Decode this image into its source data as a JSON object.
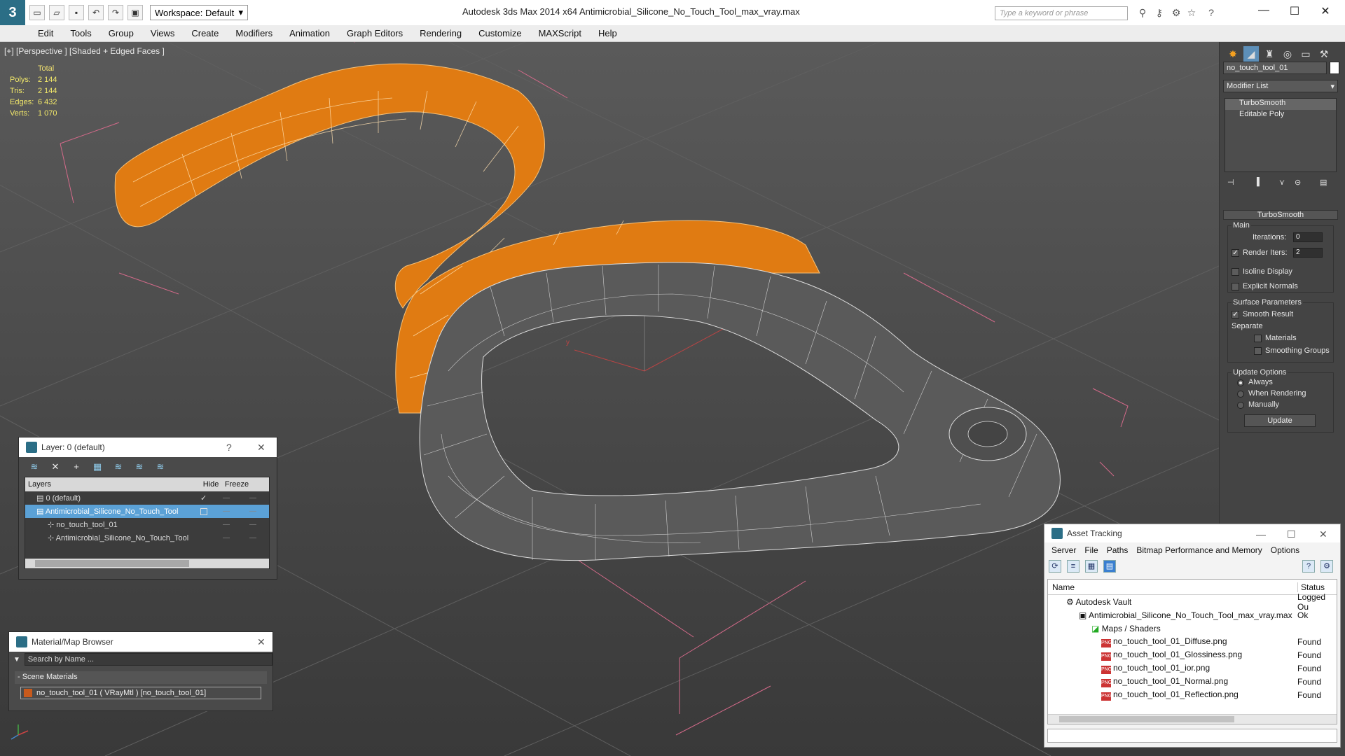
{
  "titlebar": {
    "workspace_label": "Workspace: Default",
    "app_title": "Autodesk 3ds Max  2014 x64      Antimicrobial_Silicone_No_Touch_Tool_max_vray.max",
    "search_placeholder": "Type a keyword or phrase"
  },
  "menu": [
    "Edit",
    "Tools",
    "Group",
    "Views",
    "Create",
    "Modifiers",
    "Animation",
    "Graph Editors",
    "Rendering",
    "Customize",
    "MAXScript",
    "Help"
  ],
  "viewport": {
    "label": "[+] [Perspective ] [Shaded + Edged Faces ]",
    "stats_header": "Total",
    "stats": [
      {
        "label": "Polys:",
        "value": "2 144"
      },
      {
        "label": "Tris:",
        "value": "2 144"
      },
      {
        "label": "Edges:",
        "value": "6 432"
      },
      {
        "label": "Verts:",
        "value": "1 070"
      }
    ],
    "axis_labels": {
      "x": "x",
      "y": "y"
    },
    "accent_orange": "#e07b12",
    "mesh_gray": "#5c5c5c"
  },
  "command_panel": {
    "object_name": "no_touch_tool_01",
    "modifier_list": "Modifier List",
    "stack": [
      "TurboSmooth",
      "Editable Poly"
    ],
    "rollout_title": "TurboSmooth",
    "main_label": "Main",
    "iterations_label": "Iterations:",
    "iterations_value": "0",
    "render_iters_label": "Render Iters:",
    "render_iters_value": "2",
    "isoline_label": "Isoline Display",
    "explicit_normals_label": "Explicit Normals",
    "surface_params_label": "Surface Parameters",
    "smooth_result_label": "Smooth Result",
    "separate_label": "Separate",
    "materials_label": "Materials",
    "smoothing_groups_label": "Smoothing Groups",
    "update_options_label": "Update Options",
    "always_label": "Always",
    "when_rendering_label": "When Rendering",
    "manually_label": "Manually",
    "update_button": "Update"
  },
  "layer_window": {
    "title": "Layer: 0 (default)",
    "help": "?",
    "columns": {
      "layers": "Layers",
      "hide": "Hide",
      "freeze": "Freeze"
    },
    "rows": [
      {
        "name": "0 (default)",
        "indent": 1,
        "selected": false
      },
      {
        "name": "Antimicrobial_Silicone_No_Touch_Tool",
        "indent": 1,
        "selected": true
      },
      {
        "name": "no_touch_tool_01",
        "indent": 2,
        "selected": false
      },
      {
        "name": "Antimicrobial_Silicone_No_Touch_Tool",
        "indent": 2,
        "selected": false
      }
    ]
  },
  "material_browser": {
    "title": "Material/Map Browser",
    "search_placeholder": "Search by Name ...",
    "section": "- Scene Materials",
    "item": "no_touch_tool_01  ( VRayMtl )  [no_touch_tool_01]"
  },
  "asset_tracking": {
    "title": "Asset Tracking",
    "menu": [
      "Server",
      "File",
      "Paths",
      "Bitmap Performance and Memory",
      "Options"
    ],
    "columns": {
      "name": "Name",
      "status": "Status"
    },
    "rows": [
      {
        "name": "Autodesk Vault",
        "status": "Logged Ou",
        "indent": 1
      },
      {
        "name": "Antimicrobial_Silicone_No_Touch_Tool_max_vray.max",
        "status": "Ok",
        "indent": 2
      },
      {
        "name": "Maps / Shaders",
        "status": "",
        "indent": 3
      },
      {
        "name": "no_touch_tool_01_Diffuse.png",
        "status": "Found",
        "indent": 4
      },
      {
        "name": "no_touch_tool_01_Glossiness.png",
        "status": "Found",
        "indent": 4
      },
      {
        "name": "no_touch_tool_01_ior.png",
        "status": "Found",
        "indent": 4
      },
      {
        "name": "no_touch_tool_01_Normal.png",
        "status": "Found",
        "indent": 4
      },
      {
        "name": "no_touch_tool_01_Reflection.png",
        "status": "Found",
        "indent": 4
      }
    ]
  }
}
